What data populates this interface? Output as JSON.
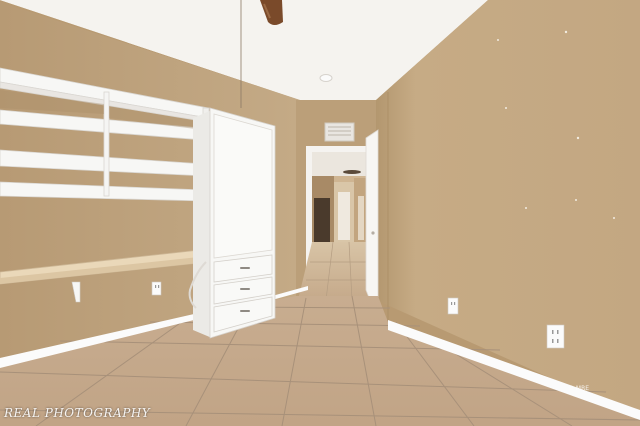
{
  "watermark": {
    "text": "REAL PHOTOGRAPHY",
    "corner_mark": "© MRE"
  },
  "colors": {
    "ceiling": "#f4f2ee",
    "wall_left": "#bea47f",
    "wall_right": "#c4a882",
    "wall_back": "#b99d77",
    "floor_tile": "#c9ad8f",
    "grout": "#a8917a",
    "cabinet": "#f7f7f5",
    "baseboard": "#fbfbfb",
    "desk_top": "#ead8b9",
    "fan_blade": "#7a4a2a"
  },
  "icons": [
    "ceiling-fan-icon",
    "smoke-detector-icon",
    "hvac-vent-icon",
    "outlet-icon"
  ]
}
